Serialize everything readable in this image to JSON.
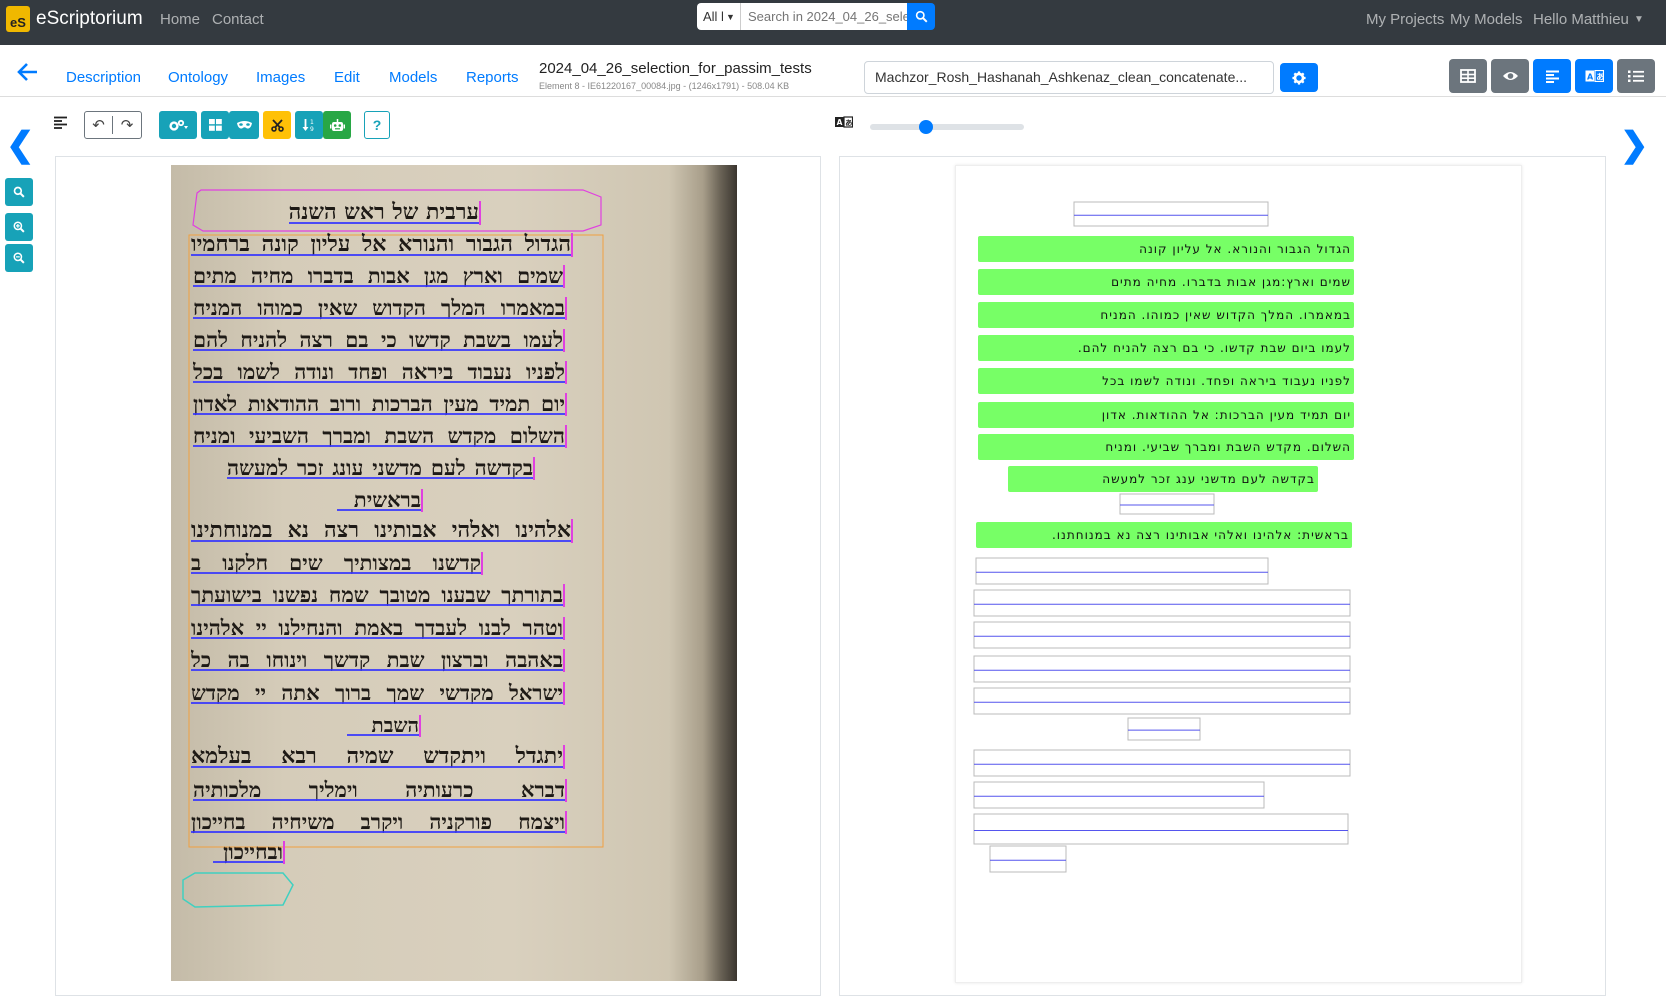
{
  "navbar": {
    "brand_icon": "eS",
    "brand": "eScriptorium",
    "links": [
      "Home",
      "Contact"
    ],
    "search_scope": "All l",
    "search_placeholder": "Search in 2024_04_26_sele",
    "right": [
      "My Projects",
      "My Models",
      "Hello Matthieu"
    ]
  },
  "tabs": [
    "Description",
    "Ontology",
    "Images",
    "Edit",
    "Models",
    "Reports"
  ],
  "document": {
    "title": "2024_04_26_selection_for_passim_tests",
    "subtitle": "Element 8 - IE61220167_00084.jpg - (1246x1791) - 508.04 KB"
  },
  "transcription": {
    "selected": "Machzor_Rosh_Hashanah_Ashkenaz_clean_concatenate..."
  },
  "toolbar": {
    "help_label": "?"
  },
  "slider": {
    "value_fraction": 0.35
  },
  "source_lines": [
    "ערבית של ראש השנה",
    "הגדול הגבור והנורא אל עליון קונה ברחמיו",
    "שמים וארץ מגן אבות בדברו מחיה מתים",
    "במאמרו המלך הקדוש שאין כמוהו המניח",
    "לעמו בשבת קדשו כי בם רצה להניח להם",
    "לפניו נעבוד ביראה ופחד ונודה לשמו בכל",
    "יום תמיד מעין הברכות ורוב ההודאות לאדון",
    "השלום מקדש השבת ומברך השביעי ומניח",
    "בקדשה לעם מדשני עונג זכר למעשה",
    "בראשית",
    "אלהינו ואלהי אבותינו רצה נא במנוחתינו",
    "קדשנו במצותיך שים חלקנו ב",
    "בתורתך שבענו מטובך שמח נפשנו בישועתך",
    "וטהר לבנו לעבדך באמת והנחילנו יי אלהינו",
    "באהבה וברצון שבת קדשך וינוחו בה כל",
    "ישראל מקדשי שמך ברוך אתה יי מקדש",
    "השבת",
    "יתגדל ויתקדש שמיה רבא בעלמא",
    "דברא כרעותיה וימליך מלכותיה",
    "ויצמח פורקניה ויקרב משיחיה בחייכון",
    "ובחייכון"
  ],
  "transcribed_lines": [
    "הגדול הגבור והנורא. אל עליון קונה",
    "שמים וארץ:מגן אבות בדברו. מחיה מתים",
    "במאמרו. המלך הקדוש שאין כמוהו. המניח",
    "לעמו ביום שבת קדשו. כי בם רצה להניח להם.",
    "לפניו נעבוד ביראה ופחד. ונודה לשמו בכל",
    "יום תמיד מעין הברכות: אל ההודאות. אדון",
    "השלום. מקדש השבת ומברך שביעי. ומניח",
    "בקדשה לעם מדשני ענג זכר למעשה",
    "בראשית: אלהינו ואלהי אבותינו רצה נא במנוחתנו."
  ],
  "colors": {
    "navbar_bg": "#343a40",
    "primary": "#007bff",
    "info": "#17a2b8",
    "warning": "#ffc107",
    "success": "#28a745",
    "secondary": "#6c757d",
    "region_outline": "#e040e0",
    "baseline": "#3333ff",
    "transcribed_mask": "#77ff66"
  }
}
